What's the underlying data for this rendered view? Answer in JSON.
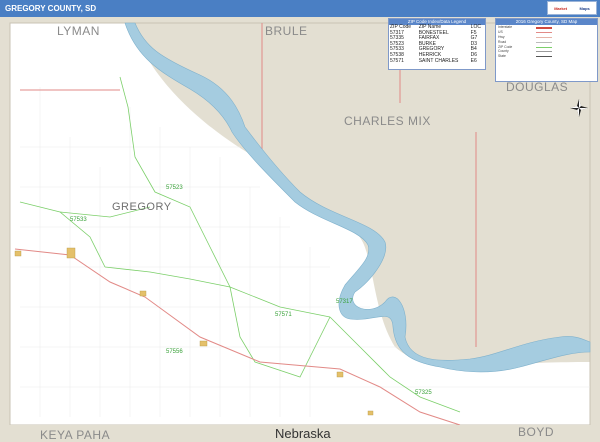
{
  "header": {
    "title": "GREGORY COUNTY, SD"
  },
  "logo": {
    "line1": "Market",
    "line2": "Maps"
  },
  "map": {
    "main_county": "GREGORY",
    "state_label": "Nebraska",
    "neighbors": {
      "lyman": "LYMAN",
      "brule": "BRULE",
      "douglas": "DOUGLAS",
      "charles_mix": "CHARLES MIX",
      "keya_paha": "KEYA PAHA",
      "boyd": "BOYD"
    },
    "zip_labels": [
      "57523",
      "57533",
      "57571",
      "57317",
      "57556",
      "57325"
    ],
    "colors": {
      "water": "#a5cce0",
      "neighbor_land": "#e3dfd2",
      "county_land": "#ffffff",
      "zip_boundary": "#7ccf6a",
      "highway": "#e28a87",
      "title_bar": "#4a7fc4"
    }
  },
  "zip_legend": {
    "title": "ZIP Code Index/Data Legend",
    "columns": [
      "ZIP Code",
      "ZIP Name",
      "LOC"
    ],
    "rows": [
      [
        "57317",
        "BONESTEEL",
        "F5"
      ],
      [
        "57335",
        "FAIRFAX",
        "G7"
      ],
      [
        "57523",
        "BURKE",
        "D3"
      ],
      [
        "57533",
        "GREGORY",
        "B4"
      ],
      [
        "57538",
        "HERRICK",
        "D6"
      ],
      [
        "57571",
        "SAINT CHARLES",
        "E6"
      ]
    ]
  },
  "map_legend": {
    "title": "2016 Gregory County, SD Map",
    "rows": [
      "Interstate",
      "US",
      "Hwy",
      "Road",
      "ZIP Code",
      "County",
      "State"
    ]
  },
  "compass": {
    "label": "N"
  }
}
